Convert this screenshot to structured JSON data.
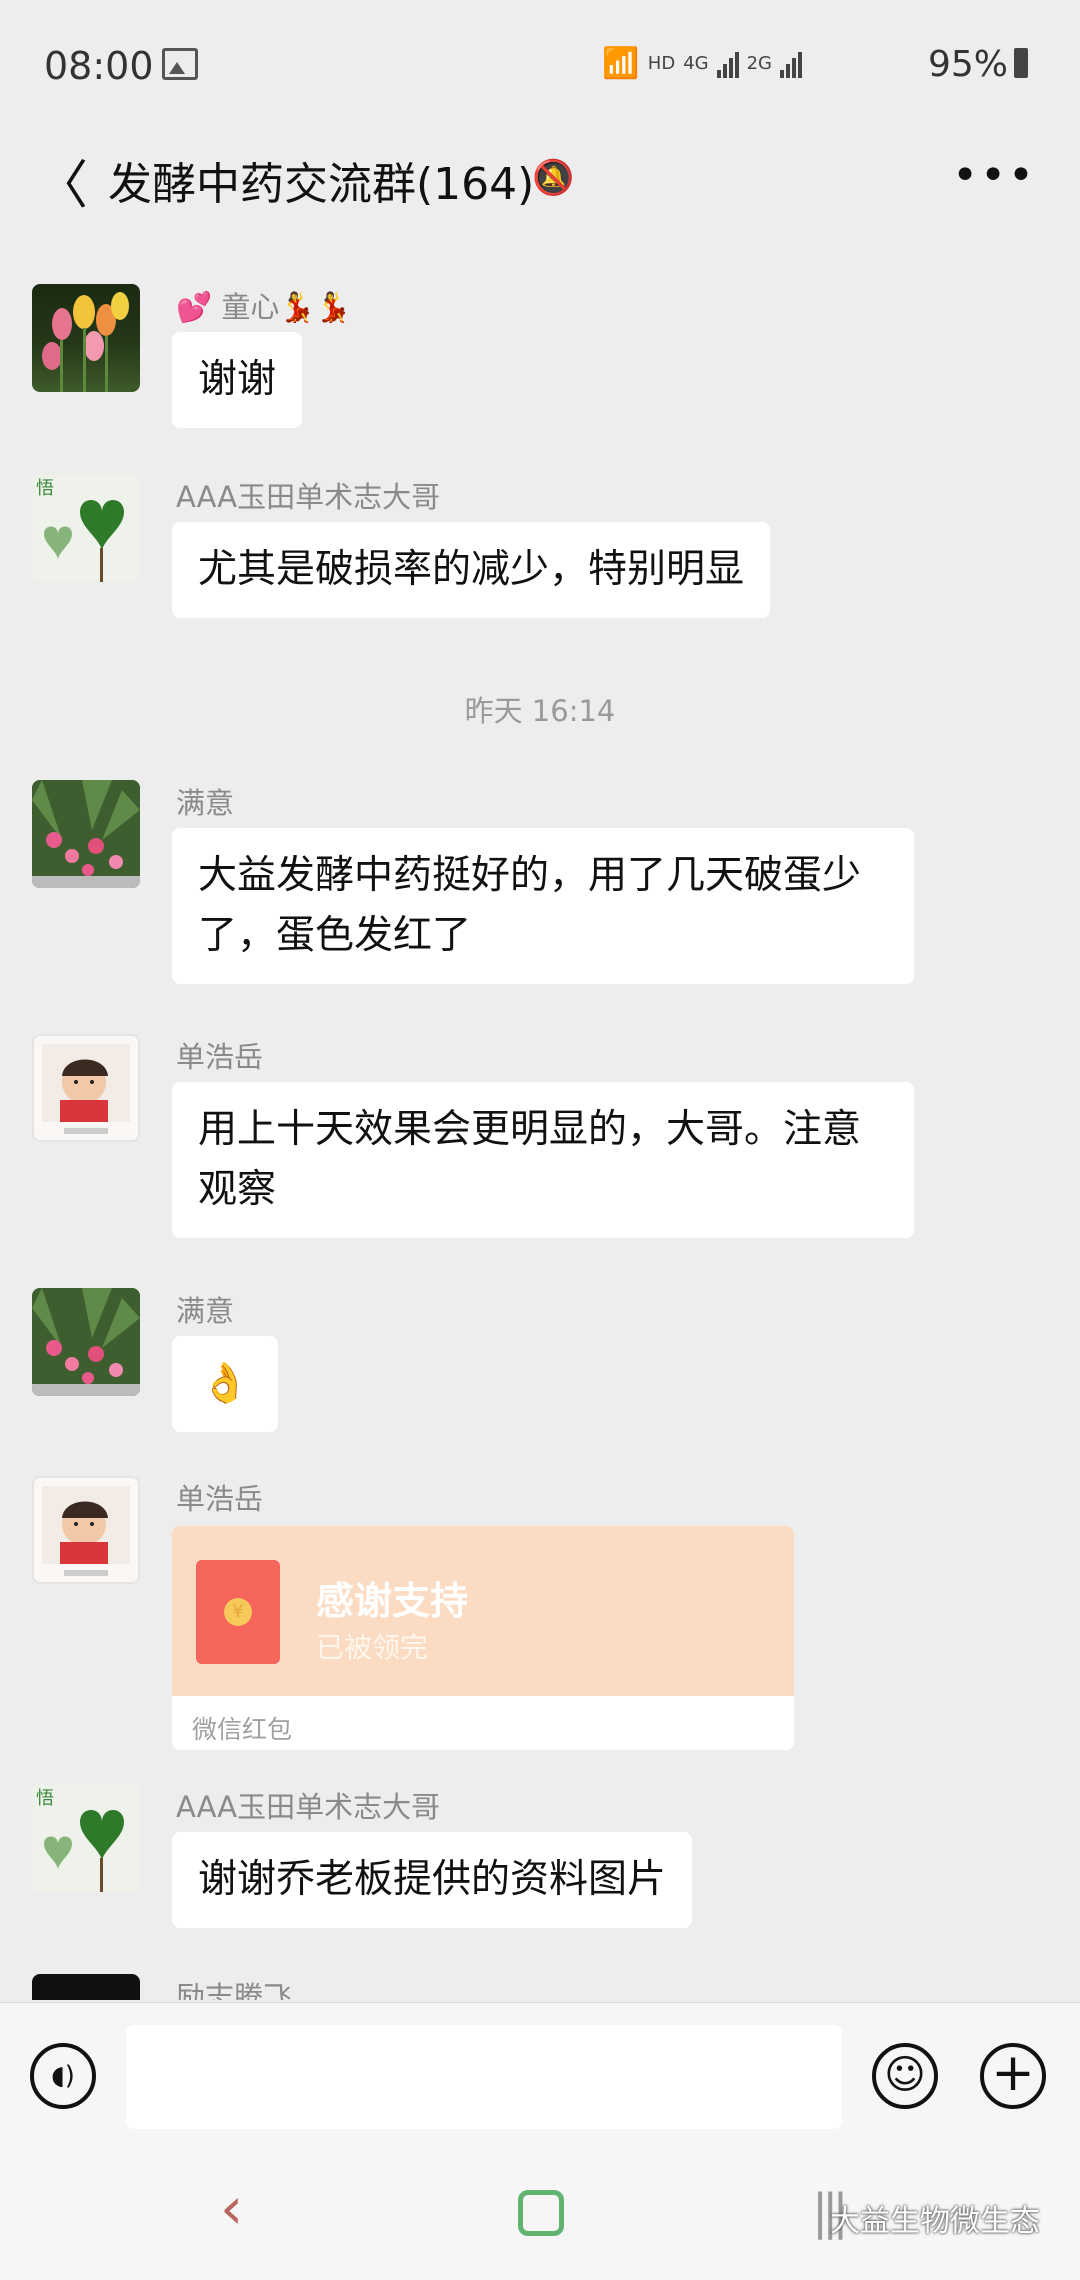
{
  "status_bar": {
    "time": "08:00",
    "net_badge": "HD",
    "net1": "4G",
    "net2": "2G",
    "battery": "95%"
  },
  "header": {
    "title": "发酵中药交流群(164)"
  },
  "messages": [
    {
      "sender": "💕 童心💃💃",
      "text": "谢谢"
    },
    {
      "sender": "AAA玉田单术志大哥",
      "text": "尤其是破损率的减少，特别明显"
    },
    {
      "sender": "满意",
      "text": "大益发酵中药挺好的，用了几天破蛋少了，蛋色发红了"
    },
    {
      "sender": "单浩岳",
      "text": "用上十天效果会更明显的，大哥。注意观察"
    },
    {
      "sender": "满意",
      "text": "👌"
    },
    {
      "sender": "单浩岳"
    },
    {
      "sender": "AAA玉田单术志大哥",
      "text": "谢谢乔老板提供的资料图片"
    },
    {
      "sender": "励志腾飞"
    }
  ],
  "timestamp": "昨天 16:14",
  "red_packet": {
    "title": "感谢支持",
    "status": "已被领完",
    "source": "微信红包"
  },
  "input_bar": {
    "placeholder": ""
  },
  "watermark": "大益生物微生态"
}
